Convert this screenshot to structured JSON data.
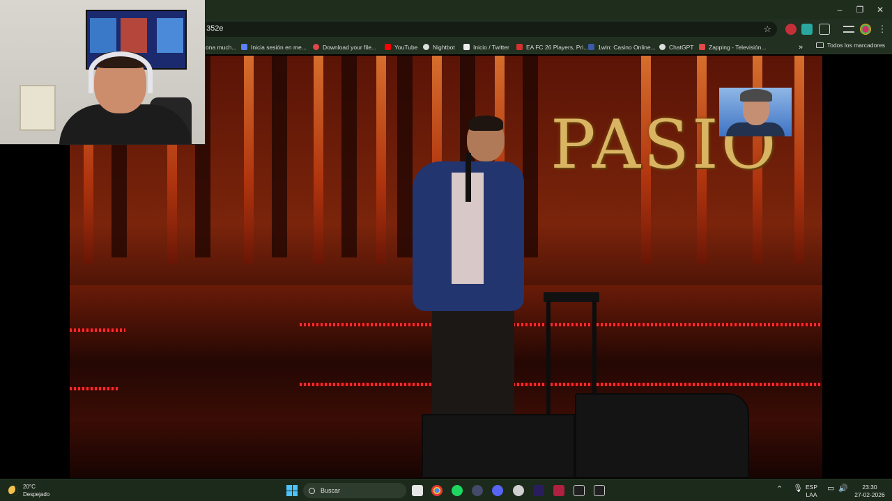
{
  "browser": {
    "url_fragment": "352e",
    "window_controls": {
      "minimize": "–",
      "restore": "❐",
      "close": "✕"
    },
    "bookmarks": [
      {
        "label": "ona much...",
        "color": "#888888"
      },
      {
        "label": "Inicia sesión en me...",
        "color": "#5b7fff"
      },
      {
        "label": "Download your file...",
        "color": "#e04848"
      },
      {
        "label": "YouTube",
        "color": "#ff0000"
      },
      {
        "label": "Nightbot",
        "color": "#dddddd"
      },
      {
        "label": "Inicio / Twitter",
        "color": "#eeeeee"
      },
      {
        "label": "EA FC 26 Players, Pri...",
        "color": "#d6302f"
      },
      {
        "label": "1win: Casino Online...",
        "color": "#3a5aa8"
      },
      {
        "label": "ChatGPT",
        "color": "#dddddd"
      },
      {
        "label": "Zapping - Televisión...",
        "color": "#e24a4a"
      }
    ],
    "more_bookmarks": "»",
    "all_bookmarks": "Todos los marcadores"
  },
  "video": {
    "stage_sign": "PASIO"
  },
  "taskbar": {
    "weather": {
      "temp": "20°C",
      "condition": "Despejado"
    },
    "search_placeholder": "Buscar",
    "language": {
      "line1": "ESP",
      "line2": "LAA"
    },
    "clock": {
      "time": "23:30",
      "date": "27-02-2026"
    },
    "apps": [
      {
        "name": "file-explorer-icon",
        "color": "#e6e6e6"
      },
      {
        "name": "chrome-icon",
        "color": "#4caf50"
      },
      {
        "name": "spotify-icon",
        "color": "#1ed760"
      },
      {
        "name": "app-icon",
        "color": "#444a6a"
      },
      {
        "name": "discord-icon",
        "color": "#5865f2"
      },
      {
        "name": "notification-app-icon",
        "color": "#d0d0d0"
      },
      {
        "name": "premiere-icon",
        "color": "#2a1d5e"
      },
      {
        "name": "affinity-icon",
        "color": "#b02040"
      },
      {
        "name": "app-m-icon",
        "color": "#202020"
      },
      {
        "name": "app-m2-icon",
        "color": "#202020"
      }
    ]
  }
}
